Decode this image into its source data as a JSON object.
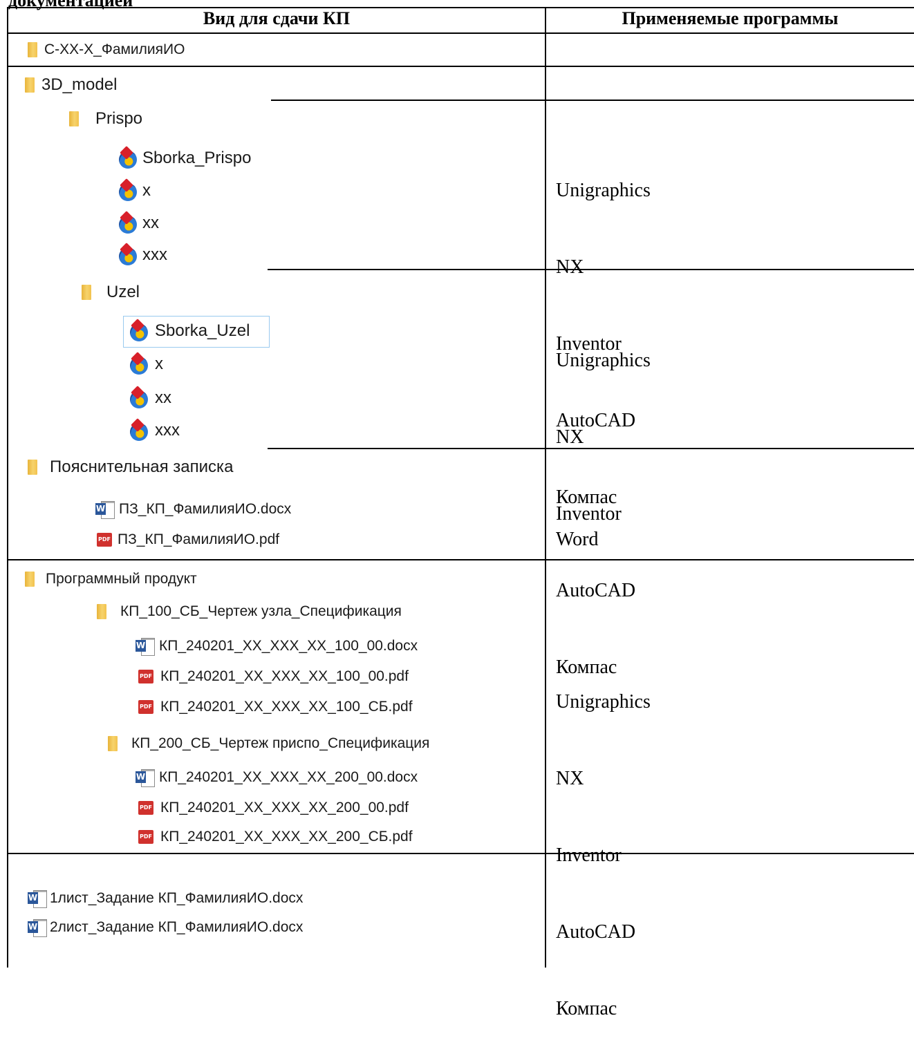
{
  "top_text": "документацией",
  "header": {
    "col1": "Вид для сдачи КП",
    "col2": "Применяемые программы"
  },
  "rows": [
    {
      "items": [
        {
          "icon": "folder-icon",
          "label": "С-ХХ-Х_ФамилияИО"
        }
      ],
      "programs": []
    },
    {
      "items": [
        {
          "icon": "folder-icon",
          "label": "3D_model"
        }
      ],
      "programs": []
    },
    {
      "items": [
        {
          "icon": "folder-icon",
          "label": "Prispo"
        },
        {
          "icon": "nx-part-icon",
          "label": "Sborka_Prispo"
        },
        {
          "icon": "nx-part-icon",
          "label": "x"
        },
        {
          "icon": "nx-part-icon",
          "label": "xx"
        },
        {
          "icon": "nx-part-icon",
          "label": "xxx"
        }
      ],
      "programs": [
        "Unigraphics",
        "NX",
        "Inventor",
        "AutoCAD",
        "Компас"
      ]
    },
    {
      "items": [
        {
          "icon": "folder-icon",
          "label": "Uzel"
        },
        {
          "icon": "nx-part-icon",
          "label": "Sborka_Uzel"
        },
        {
          "icon": "nx-part-icon",
          "label": "x"
        },
        {
          "icon": "nx-part-icon",
          "label": "xx"
        },
        {
          "icon": "nx-part-icon",
          "label": "xxx"
        }
      ],
      "programs": [
        "Unigraphics",
        "NX",
        "Inventor",
        "AutoCAD",
        "Компас"
      ]
    },
    {
      "items": [
        {
          "icon": "folder-icon",
          "label": "Пояснительная записка"
        },
        {
          "icon": "word-icon",
          "label": "ПЗ_КП_ФамилияИО.docx"
        },
        {
          "icon": "pdf-icon",
          "label": "ПЗ_КП_ФамилияИО.pdf"
        }
      ],
      "programs": [
        "Word"
      ]
    },
    {
      "items": [
        {
          "icon": "folder-icon",
          "label": "Программный продукт"
        },
        {
          "icon": "folder-icon",
          "label": "КП_100_СБ_Чертеж узла_Спецификация"
        },
        {
          "icon": "word-icon",
          "label": "КП_240201_ХХ_ХХХ_ХХ_100_00.docx"
        },
        {
          "icon": "pdf-icon",
          "label": "КП_240201_ХХ_ХХХ_ХХ_100_00.pdf"
        },
        {
          "icon": "pdf-icon",
          "label": "КП_240201_ХХ_ХХХ_ХХ_100_СБ.pdf"
        },
        {
          "icon": "folder-icon",
          "label": "КП_200_СБ_Чертеж приспо_Спецификация"
        },
        {
          "icon": "word-icon",
          "label": "КП_240201_ХХ_ХХХ_ХХ_200_00.docx"
        },
        {
          "icon": "pdf-icon",
          "label": "КП_240201_ХХ_ХХХ_ХХ_200_00.pdf"
        },
        {
          "icon": "pdf-icon",
          "label": "КП_240201_ХХ_ХХХ_ХХ_200_СБ.pdf"
        }
      ],
      "programs": [
        "Unigraphics",
        "NX",
        "Inventor",
        "AutoCAD",
        "Компас"
      ]
    },
    {
      "items": [
        {
          "icon": "word-icon",
          "label": "1лист_Задание КП_ФамилияИО.docx"
        },
        {
          "icon": "word-icon",
          "label": "2лист_Задание КП_ФамилияИО.docx"
        }
      ],
      "programs": []
    }
  ]
}
